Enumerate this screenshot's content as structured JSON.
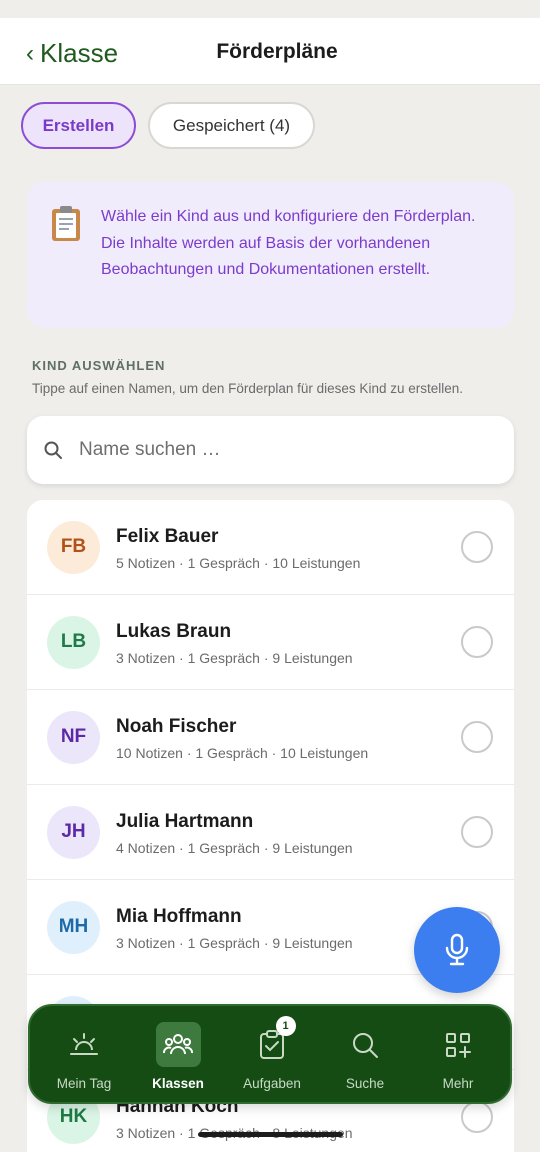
{
  "header": {
    "back_label": "Klasse",
    "title": "Förderpläne"
  },
  "segment": {
    "create_label": "Erstellen",
    "saved_label": "Gespeichert (4)"
  },
  "info": {
    "icon": "clipboard-icon",
    "text": "Wähle ein Kind aus und konfiguriere den Förderplan. Die Inhalte werden auf Basis der vorhandenen Beobachtungen und Dokumentationen erstellt."
  },
  "section": {
    "label": "KIND AUSWÄHLEN",
    "hint": "Tippe auf einen Namen, um den Förderplan für dieses Kind zu erstellen."
  },
  "search": {
    "placeholder": "Name suchen …"
  },
  "children": [
    {
      "initials": "FB",
      "name": "Felix Bauer",
      "meta": "5 Notizen · 1 Gespräch · 10 Leistungen",
      "avatar_bg": "#fdebd9",
      "avatar_fg": "#b0531a"
    },
    {
      "initials": "LB",
      "name": "Lukas Braun",
      "meta": "3 Notizen · 1 Gespräch · 9 Leistungen",
      "avatar_bg": "#daf5e6",
      "avatar_fg": "#1f7a45"
    },
    {
      "initials": "NF",
      "name": "Noah Fischer",
      "meta": "10 Notizen · 1 Gespräch · 10 Leistungen",
      "avatar_bg": "#ece6fb",
      "avatar_fg": "#5c2aa6"
    },
    {
      "initials": "JH",
      "name": "Julia Hartmann",
      "meta": "4 Notizen · 1 Gespräch · 9 Leistungen",
      "avatar_bg": "#ece6fb",
      "avatar_fg": "#5c2aa6"
    },
    {
      "initials": "MH",
      "name": "Mia Hoffmann",
      "meta": "3 Notizen · 1 Gespräch · 9 Leistungen",
      "avatar_bg": "#e0effc",
      "avatar_fg": "#1e6aa8"
    },
    {
      "initials": "",
      "name": "",
      "meta": "",
      "avatar_bg": "#e0effc",
      "avatar_fg": "#1e6aa8"
    },
    {
      "initials": "HK",
      "name": "Hannah Koch",
      "meta": "3 Notizen · 1 Gespräch · 8 Leistungen",
      "avatar_bg": "#daf5e6",
      "avatar_fg": "#1f7a45"
    }
  ],
  "fab": {
    "icon": "microphone-icon"
  },
  "nav": {
    "items": [
      {
        "label": "Mein Tag",
        "icon": "sunrise-icon"
      },
      {
        "label": "Klassen",
        "icon": "people-icon"
      },
      {
        "label": "Aufgaben",
        "icon": "clipboard-check-icon",
        "badge": "1"
      },
      {
        "label": "Suche",
        "icon": "search-icon"
      },
      {
        "label": "Mehr",
        "icon": "grid-plus-icon"
      }
    ],
    "active": "Klassen"
  },
  "colors": {
    "brand_green": "#144c14",
    "accent_purple": "#7b3ccc",
    "fab_blue": "#3c7ef0"
  }
}
